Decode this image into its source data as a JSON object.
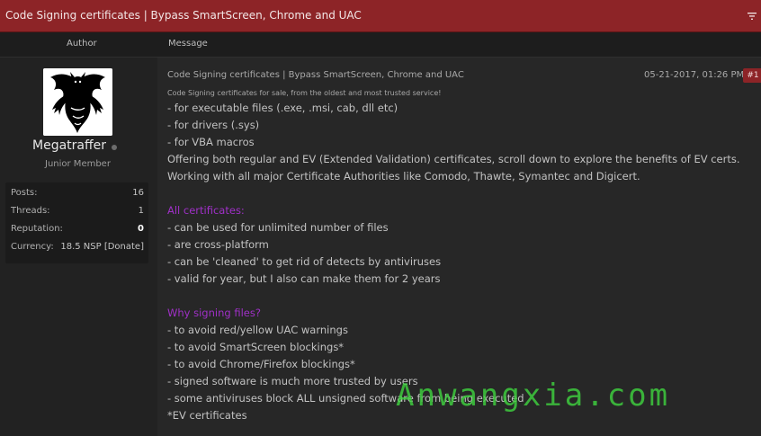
{
  "thread": {
    "title": "Code Signing certificates | Bypass SmartScreen, Chrome and UAC",
    "filter_icon": "filter-icon"
  },
  "columns": {
    "author": "Author",
    "message": "Message"
  },
  "author": {
    "username": "Megatraffer",
    "rank": "Junior Member",
    "stats": [
      {
        "label": "Posts:",
        "value": "16"
      },
      {
        "label": "Threads:",
        "value": "1"
      },
      {
        "label": "Reputation:",
        "value": "0"
      },
      {
        "label": "Currency:",
        "value": "18.5 NSP [Donate]"
      }
    ]
  },
  "post": {
    "subject": "Code Signing certificates | Bypass SmartScreen, Chrome and UAC",
    "date": "05-21-2017, 01:26 PM",
    "number": "#1",
    "lines": [
      {
        "text": "Code Signing certificates for sale, from the oldest and most trusted service!",
        "style": "small"
      },
      {
        "text": "- for executable files (.exe, .msi, cab, dll etc)",
        "style": "normal"
      },
      {
        "text": "- for drivers (.sys)",
        "style": "normal"
      },
      {
        "text": "- for VBA macros",
        "style": "normal"
      },
      {
        "text": "Offering both regular and EV (Extended Validation) certificates, scroll down to explore the benefits of EV certs.",
        "style": "normal"
      },
      {
        "text": "Working with all major Certificate Authorities like Comodo, Thawte, Symantec and Digicert.",
        "style": "normal"
      },
      {
        "text": "All certificates:",
        "style": "heading"
      },
      {
        "text": "- can be used for unlimited number of files",
        "style": "normal"
      },
      {
        "text": "- are cross-platform",
        "style": "normal"
      },
      {
        "text": "- can be 'cleaned' to get rid of detects by antiviruses",
        "style": "normal"
      },
      {
        "text": "- valid for year, but I also can make them for 2 years",
        "style": "normal"
      },
      {
        "text": "Why signing files?",
        "style": "heading"
      },
      {
        "text": "- to avoid red/yellow UAC warnings",
        "style": "normal"
      },
      {
        "text": "- to avoid SmartScreen blockings*",
        "style": "normal"
      },
      {
        "text": "- to avoid Chrome/Firefox blockings*",
        "style": "normal"
      },
      {
        "text": "- signed software is much more trusted by users",
        "style": "normal"
      },
      {
        "text": "- some antiviruses block ALL unsigned software from being executed",
        "style": "normal"
      },
      {
        "text": "*EV certificates",
        "style": "normal"
      }
    ]
  },
  "watermark": "Anwangxia.com"
}
